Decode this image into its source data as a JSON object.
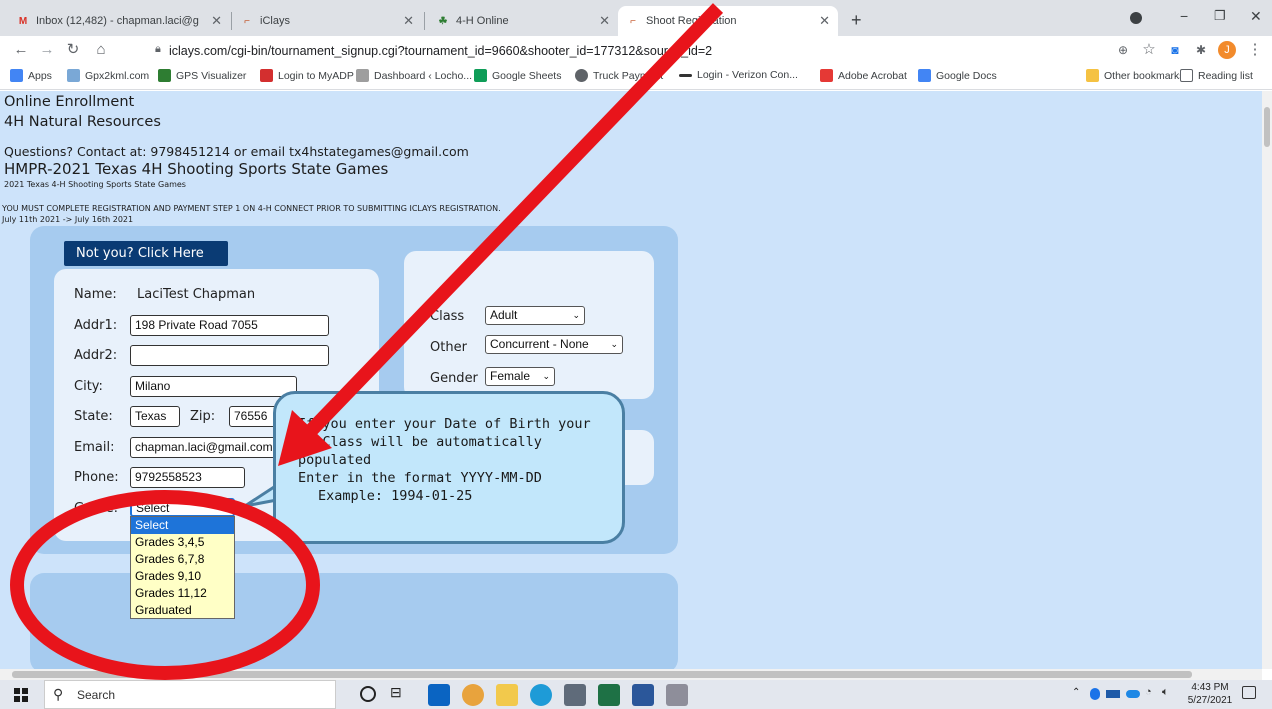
{
  "browser": {
    "tabs": [
      {
        "title": "Inbox (12,482) - chapman.laci@g",
        "icon": "gmail-icon"
      },
      {
        "title": "iClays",
        "icon": "iclays-icon"
      },
      {
        "title": "4-H Online",
        "icon": "4h-icon"
      },
      {
        "title": "Shoot Registration",
        "icon": "iclays-icon"
      }
    ],
    "new_tab": "+",
    "url": "iclays.com/cgi-bin/tournament_signup.cgi?tournament_id=9660&shooter_id=177312&source_id=2",
    "profile_initial": "J",
    "bookmarks": [
      {
        "label": "Apps",
        "color": "#4285f4"
      },
      {
        "label": "Gpx2kml.com",
        "color": "#7aa8d6"
      },
      {
        "label": "GPS Visualizer",
        "color": "#2e7d32"
      },
      {
        "label": "Login to MyADP",
        "color": "#d32f2f"
      },
      {
        "label": "Dashboard ‹ Locho...",
        "color": "#9e9e9e"
      },
      {
        "label": "Google Sheets",
        "color": "#0f9d58"
      },
      {
        "label": "Truck Payment",
        "color": "#5f6368"
      },
      {
        "label": "Login - Verizon Con...",
        "color": "#333333"
      },
      {
        "label": "Adobe Acrobat",
        "color": "#e53935"
      },
      {
        "label": "Google Docs",
        "color": "#4285f4"
      }
    ],
    "other_bookmarks": "Other bookmarks",
    "reading_list": "Reading list"
  },
  "page": {
    "heading1": "Online Enrollment",
    "heading2": "4H Natural Resources",
    "contact": "Questions? Contact at: 9798451214 or email tx4hstategames@gmail.com",
    "event_title": "HMPR-2021 Texas 4H Shooting Sports State Games",
    "event_subtitle": "2021 Texas 4-H Shooting Sports State Games",
    "notice": "YOU MUST COMPLETE REGISTRATION AND PAYMENT STEP 1 ON 4-H CONNECT PRIOR TO SUBMITTING ICLAYS REGISTRATION.",
    "dates": "July 11th 2021 -> July 16th 2021",
    "not_you": "Not you? Click Here",
    "form": {
      "name_label": "Name:",
      "name": "LaciTest Chapman",
      "addr1_label": "Addr1:",
      "addr1": "198 Private Road 7055",
      "addr2_label": "Addr2:",
      "addr2": "",
      "city_label": "City:",
      "city": "Milano",
      "state_label": "State:",
      "state": "Texas",
      "zip_label": "Zip:",
      "zip": "76556",
      "email_label": "Email:",
      "email": "chapman.laci@gmail.com",
      "phone_label": "Phone:",
      "phone": "9792558523",
      "grade_label": "Grade:",
      "grade": "Select"
    },
    "side": {
      "class_label": "Class",
      "class_value": "Adult",
      "other_label": "Other",
      "other_value": "Concurrent - None",
      "gender_label": "Gender",
      "gender_value": "Female"
    },
    "grade_options": [
      "Select",
      "Grades 3,4,5",
      "Grades 6,7,8",
      "Grades 9,10",
      "Grades 11,12",
      "Graduated"
    ]
  },
  "annotation": {
    "lines": [
      "If you enter your Date of Birth your",
      "4H Class will be automatically",
      "populated",
      "Enter in the format YYYY-MM-DD",
      "Example: 1994-01-25"
    ],
    "arrow_color": "#e8141b",
    "circle_color": "#e8141b"
  },
  "taskbar": {
    "search": "Search",
    "time": "4:43 PM",
    "date": "5/27/2021"
  }
}
